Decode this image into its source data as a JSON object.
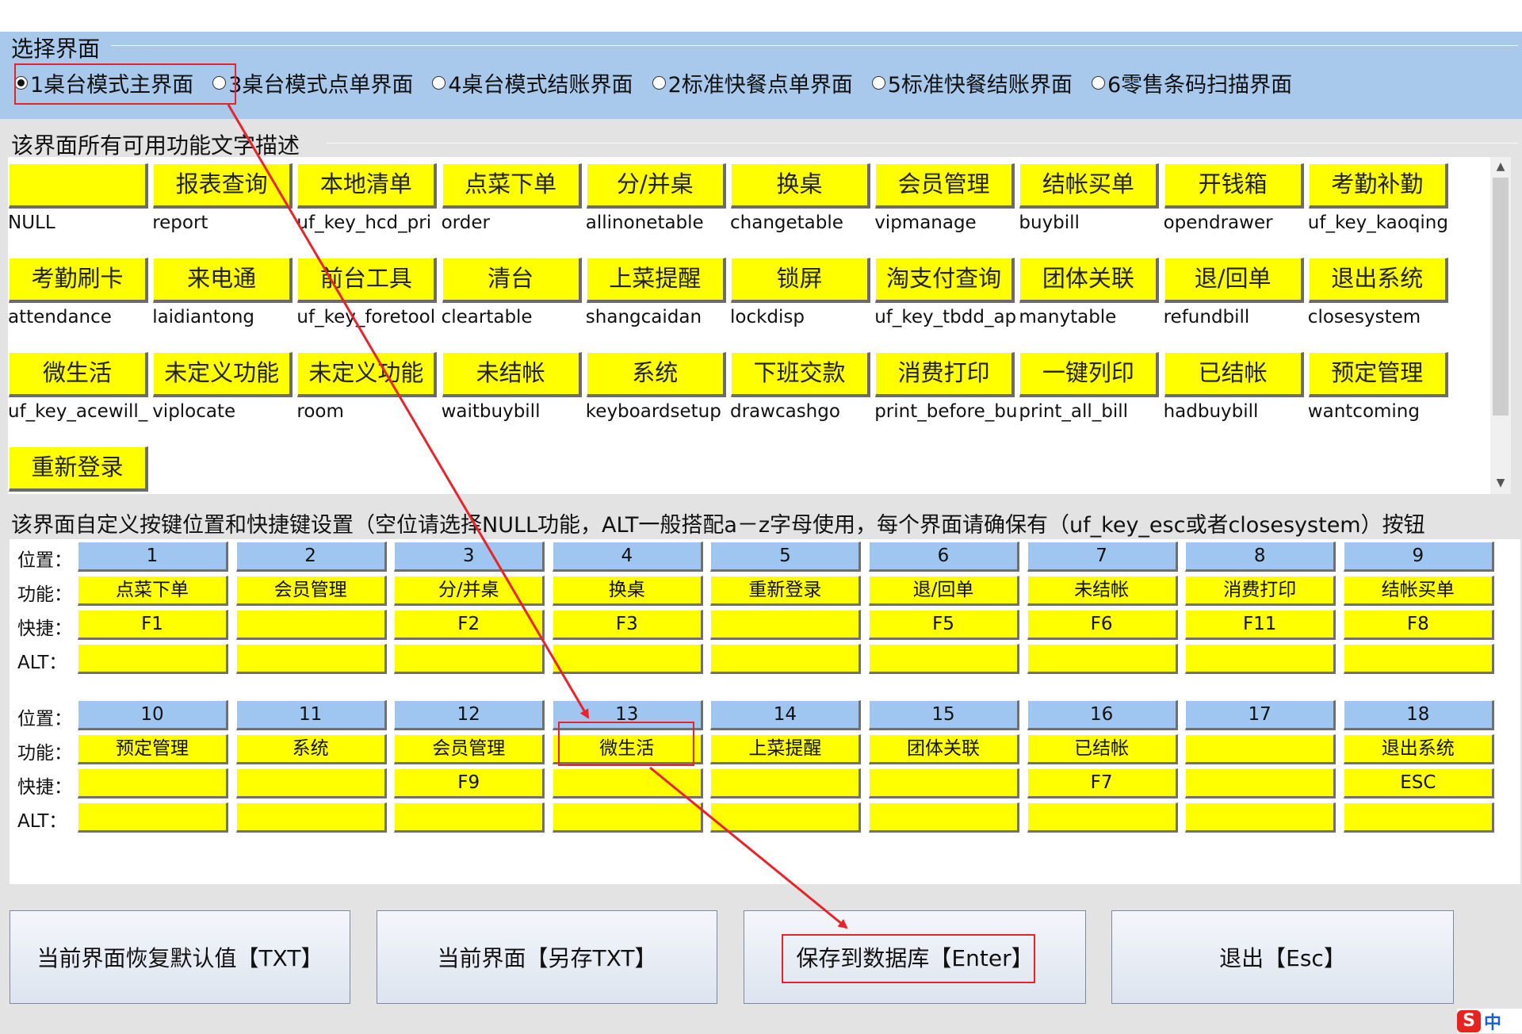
{
  "selection": {
    "title": "选择界面",
    "options": [
      {
        "label": "1桌台模式主界面",
        "selected": true
      },
      {
        "label": "3桌台模式点单界面",
        "selected": false
      },
      {
        "label": "4桌台模式结账界面",
        "selected": false
      },
      {
        "label": "2标准快餐点单界面",
        "selected": false
      },
      {
        "label": "5标准快餐结账界面",
        "selected": false
      },
      {
        "label": "6零售条码扫描界面",
        "selected": false
      }
    ]
  },
  "functions": {
    "title": "该界面所有可用功能文字描述",
    "items": [
      {
        "label": "",
        "code": "NULL"
      },
      {
        "label": "报表查询",
        "code": "report"
      },
      {
        "label": "本地清单",
        "code": "uf_key_hcd_pri"
      },
      {
        "label": "点菜下单",
        "code": "order"
      },
      {
        "label": "分/并桌",
        "code": "allinonetable"
      },
      {
        "label": "换桌",
        "code": "changetable"
      },
      {
        "label": "会员管理",
        "code": "vipmanage"
      },
      {
        "label": "结帐买单",
        "code": "buybill"
      },
      {
        "label": "开钱箱",
        "code": "opendrawer"
      },
      {
        "label": "考勤补勤",
        "code": "uf_key_kaoqing"
      },
      {
        "label": "考勤刷卡",
        "code": "attendance"
      },
      {
        "label": "来电通",
        "code": "laidiantong"
      },
      {
        "label": "前台工具",
        "code": "uf_key_foretool"
      },
      {
        "label": "清台",
        "code": "cleartable"
      },
      {
        "label": "上菜提醒",
        "code": "shangcaidan"
      },
      {
        "label": "锁屏",
        "code": "lockdisp"
      },
      {
        "label": "淘支付查询",
        "code": "uf_key_tbdd_ap"
      },
      {
        "label": "团体关联",
        "code": "manytable"
      },
      {
        "label": "退/回单",
        "code": "refundbill"
      },
      {
        "label": "退出系统",
        "code": "closesystem"
      },
      {
        "label": "微生活",
        "code": "uf_key_acewill_"
      },
      {
        "label": "未定义功能",
        "code": "viplocate"
      },
      {
        "label": "未定义功能",
        "code": "room"
      },
      {
        "label": "未结帐",
        "code": "waitbuybill"
      },
      {
        "label": "系统",
        "code": "keyboardsetup"
      },
      {
        "label": "下班交款",
        "code": "drawcashgo"
      },
      {
        "label": "消费打印",
        "code": "print_before_bu"
      },
      {
        "label": "一键列印",
        "code": "print_all_bill"
      },
      {
        "label": "已结帐",
        "code": "hadbuybill"
      },
      {
        "label": "预定管理",
        "code": "wantcoming"
      },
      {
        "label": "重新登录",
        "code": ""
      }
    ]
  },
  "layout_settings": {
    "title": "该界面自定义按键位置和快捷键设置（空位请选择NULL功能，ALT一般搭配a－z字母使用，每个界面请确保有（uf_key_esc或者closesystem）按钮",
    "row_labels": {
      "position": "位置：",
      "function": "功能：",
      "shortcut": "快捷：",
      "alt": "ALT："
    },
    "slots": [
      {
        "pos": "1",
        "func": "点菜下单",
        "key": "F1",
        "alt": ""
      },
      {
        "pos": "2",
        "func": "会员管理",
        "key": "",
        "alt": ""
      },
      {
        "pos": "3",
        "func": "分/并桌",
        "key": "F2",
        "alt": ""
      },
      {
        "pos": "4",
        "func": "换桌",
        "key": "F3",
        "alt": ""
      },
      {
        "pos": "5",
        "func": "重新登录",
        "key": "",
        "alt": ""
      },
      {
        "pos": "6",
        "func": "退/回单",
        "key": "F5",
        "alt": ""
      },
      {
        "pos": "7",
        "func": "未结帐",
        "key": "F6",
        "alt": ""
      },
      {
        "pos": "8",
        "func": "消费打印",
        "key": "F11",
        "alt": ""
      },
      {
        "pos": "9",
        "func": "结帐买单",
        "key": "F8",
        "alt": ""
      },
      {
        "pos": "10",
        "func": "预定管理",
        "key": "",
        "alt": ""
      },
      {
        "pos": "11",
        "func": "系统",
        "key": "",
        "alt": ""
      },
      {
        "pos": "12",
        "func": "会员管理",
        "key": "F9",
        "alt": ""
      },
      {
        "pos": "13",
        "func": "微生活",
        "key": "",
        "alt": ""
      },
      {
        "pos": "14",
        "func": "上菜提醒",
        "key": "",
        "alt": ""
      },
      {
        "pos": "15",
        "func": "团体关联",
        "key": "",
        "alt": ""
      },
      {
        "pos": "16",
        "func": "已结帐",
        "key": "F7",
        "alt": ""
      },
      {
        "pos": "17",
        "func": "",
        "key": "",
        "alt": ""
      },
      {
        "pos": "18",
        "func": "退出系统",
        "key": "ESC",
        "alt": ""
      }
    ]
  },
  "buttons": {
    "restore": "当前界面恢复默认值【TXT】",
    "save_txt": "当前界面【另存TXT】",
    "save_db": "保存到数据库【Enter】",
    "exit": "退出【Esc】"
  },
  "ime": {
    "label": "中"
  },
  "colors": {
    "header_bg": "#a9c9ec",
    "button_yellow": "#ffff00",
    "position_blue": "#9ec6f0",
    "annotation_red": "#e8232a"
  }
}
